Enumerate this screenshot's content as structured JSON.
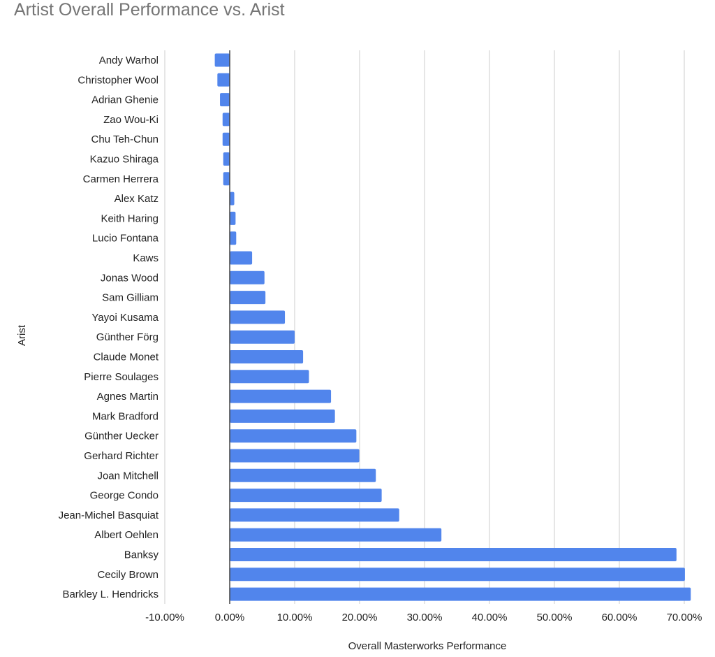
{
  "chart_data": {
    "type": "bar",
    "orientation": "horizontal",
    "title": "Artist Overall Performance vs. Arist",
    "xlabel": "Overall Masterworks Performance",
    "ylabel": "Arist",
    "xlim": [
      -10,
      70
    ],
    "x_ticks": [
      -10,
      0,
      10,
      20,
      30,
      40,
      50,
      60,
      70
    ],
    "x_tick_labels": [
      "-10.00%",
      "0.00%",
      "10.00%",
      "20.00%",
      "30.00%",
      "40.00%",
      "50.00%",
      "60.00%",
      "70.00%"
    ],
    "value_unit": "percent",
    "grid": true,
    "legend": "none",
    "bar_color": "#5185ec",
    "categories": [
      "Andy Warhol",
      "Christopher Wool",
      "Adrian Ghenie",
      "Zao Wou-Ki",
      "Chu Teh-Chun",
      "Kazuo Shiraga",
      "Carmen Herrera",
      "Alex Katz",
      "Keith Haring",
      "Lucio Fontana",
      "Kaws",
      "Jonas Wood",
      "Sam Gilliam",
      "Yayoi Kusama",
      "Günther Förg",
      "Claude Monet",
      "Pierre Soulages",
      "Agnes Martin",
      "Mark Bradford",
      "Günther Uecker",
      "Gerhard Richter",
      "Joan Mitchell",
      "George Condo",
      "Jean-Michel Basquiat",
      "Albert Oehlen",
      "Banksy",
      "Cecily Brown",
      "Barkley L. Hendricks"
    ],
    "values": [
      -2.3,
      -1.9,
      -1.5,
      -1.1,
      -1.1,
      -1.0,
      -1.0,
      0.7,
      0.9,
      1.0,
      3.45,
      5.35,
      5.5,
      8.5,
      10.0,
      11.3,
      12.2,
      15.6,
      16.2,
      19.5,
      19.95,
      22.5,
      23.4,
      26.1,
      32.6,
      68.8,
      70.1,
      71.0
    ]
  }
}
